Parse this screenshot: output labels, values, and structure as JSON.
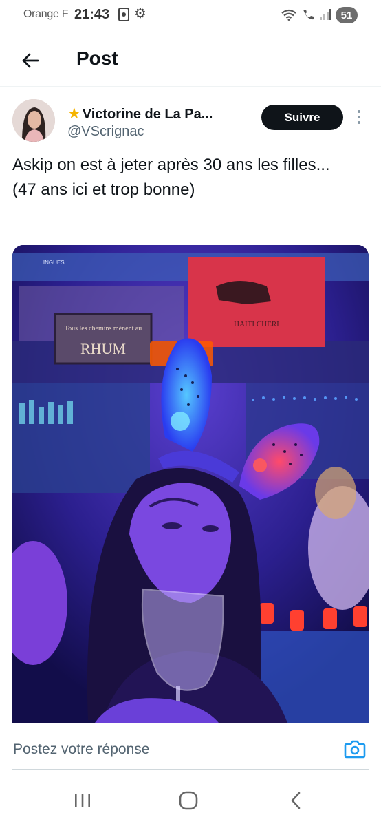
{
  "status_bar": {
    "carrier": "Orange F",
    "time": "21:43",
    "battery": "51"
  },
  "header": {
    "title": "Post"
  },
  "post": {
    "author_name": "Victorine de La Pa...",
    "author_handle": "@VScrignac",
    "follow_label": "Suivre",
    "text": "Askip on est à jeter après 30 ans les filles...\n(47 ans ici et trop bonne)",
    "media_signs": {
      "sign1": "Tous les chemins mènent au",
      "sign2": "RHUM",
      "sign3": "HAITI CHERI",
      "sign4": "LINGUES"
    }
  },
  "reply": {
    "placeholder": "Postez votre réponse"
  },
  "colors": {
    "follow_bg": "#0f1419",
    "accent": "#1d9bf0",
    "muted": "#536471"
  }
}
